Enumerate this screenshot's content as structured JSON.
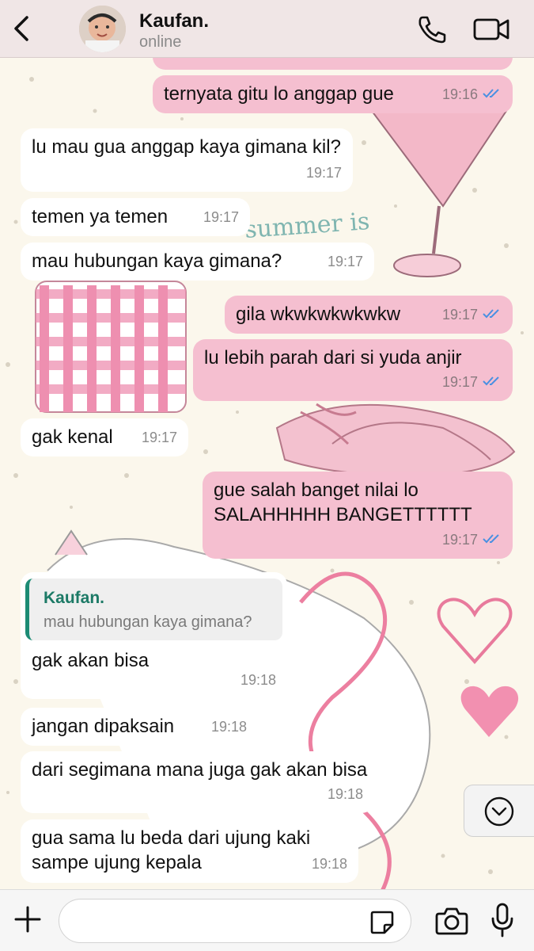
{
  "header": {
    "contact_name": "Kaufan.",
    "status": "online"
  },
  "messages": [
    {
      "dir": "out",
      "text": "ternyata gitu lo anggap gue",
      "time": "19:16",
      "read": true
    },
    {
      "dir": "in",
      "text": "lu mau gua anggap kaya gimana kil?",
      "time": "19:17"
    },
    {
      "dir": "in",
      "text": "temen ya temen",
      "time": "19:17"
    },
    {
      "dir": "in",
      "text": "mau hubungan kaya gimana?",
      "time": "19:17"
    },
    {
      "dir": "out",
      "text": "gila wkwkwkwkwkw",
      "time": "19:17",
      "read": true
    },
    {
      "dir": "out",
      "text": "lu lebih parah dari si yuda anjir",
      "time": "19:17",
      "read": true
    },
    {
      "dir": "in",
      "text": "gak kenal",
      "time": "19:17"
    },
    {
      "dir": "out",
      "text": "gue salah banget nilai lo SALAHHHHH BANGETTTTTT",
      "time": "19:17",
      "read": true
    },
    {
      "dir": "in",
      "reply_author": "Kaufan.",
      "reply_text": "mau hubungan kaya gimana?",
      "text": "gak akan bisa",
      "time": "19:18"
    },
    {
      "dir": "in",
      "text": "jangan dipaksain",
      "time": "19:18"
    },
    {
      "dir": "in",
      "text": "dari segimana mana juga gak akan bisa",
      "time": "19:18"
    },
    {
      "dir": "in",
      "text": "gua sama lu beda dari ujung kaki sampe ujung kepala",
      "time": "19:18"
    }
  ],
  "wallpaper_text": "summer is",
  "colors": {
    "outgoing_bubble": "#f5bfd0",
    "incoming_bubble": "#ffffff",
    "read_ticks": "#4a90e2",
    "reply_accent": "#1c8b74"
  },
  "icons": [
    "back-arrow",
    "phone",
    "video-camera",
    "plus",
    "sticker",
    "camera",
    "microphone",
    "chevron-down",
    "double-check"
  ]
}
